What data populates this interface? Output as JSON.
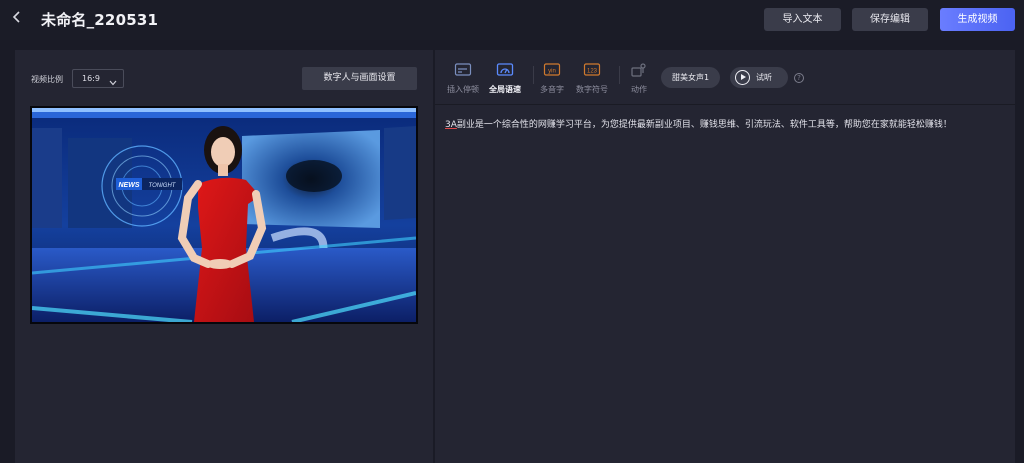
{
  "header": {
    "back_icon": "chevron-left-icon",
    "title": "未命名_220531",
    "import_label": "导入文本",
    "save_label": "保存编辑",
    "generate_label": "生成视频",
    "accent_color": "#5b70fa"
  },
  "left": {
    "ratio_label": "视频比例",
    "ratio_value": "16:9",
    "settings_label": "数字人与画面设置",
    "preview": {
      "badge_news": "NEWS",
      "badge_tonight": "TONIGHT"
    }
  },
  "right": {
    "tools": [
      {
        "label": "插入停顿",
        "icon": "insert-pause-icon"
      },
      {
        "label": "全局语速",
        "icon": "speed-gauge-icon"
      },
      {
        "label": "多音字",
        "icon": "pinyin-icon"
      },
      {
        "label": "数字符号",
        "icon": "number-symbol-icon"
      },
      {
        "label": "动作",
        "icon": "action-icon"
      }
    ],
    "voice_label": "甜美女声1",
    "listen_label": "试听",
    "help_icon": "question-circle-icon",
    "script_highlight": "3A",
    "script_rest": "副业是一个综合性的网赚学习平台，为您提供最新副业项目、赚钱思维、引流玩法、软件工具等，帮助您在家就能轻松赚钱！"
  }
}
